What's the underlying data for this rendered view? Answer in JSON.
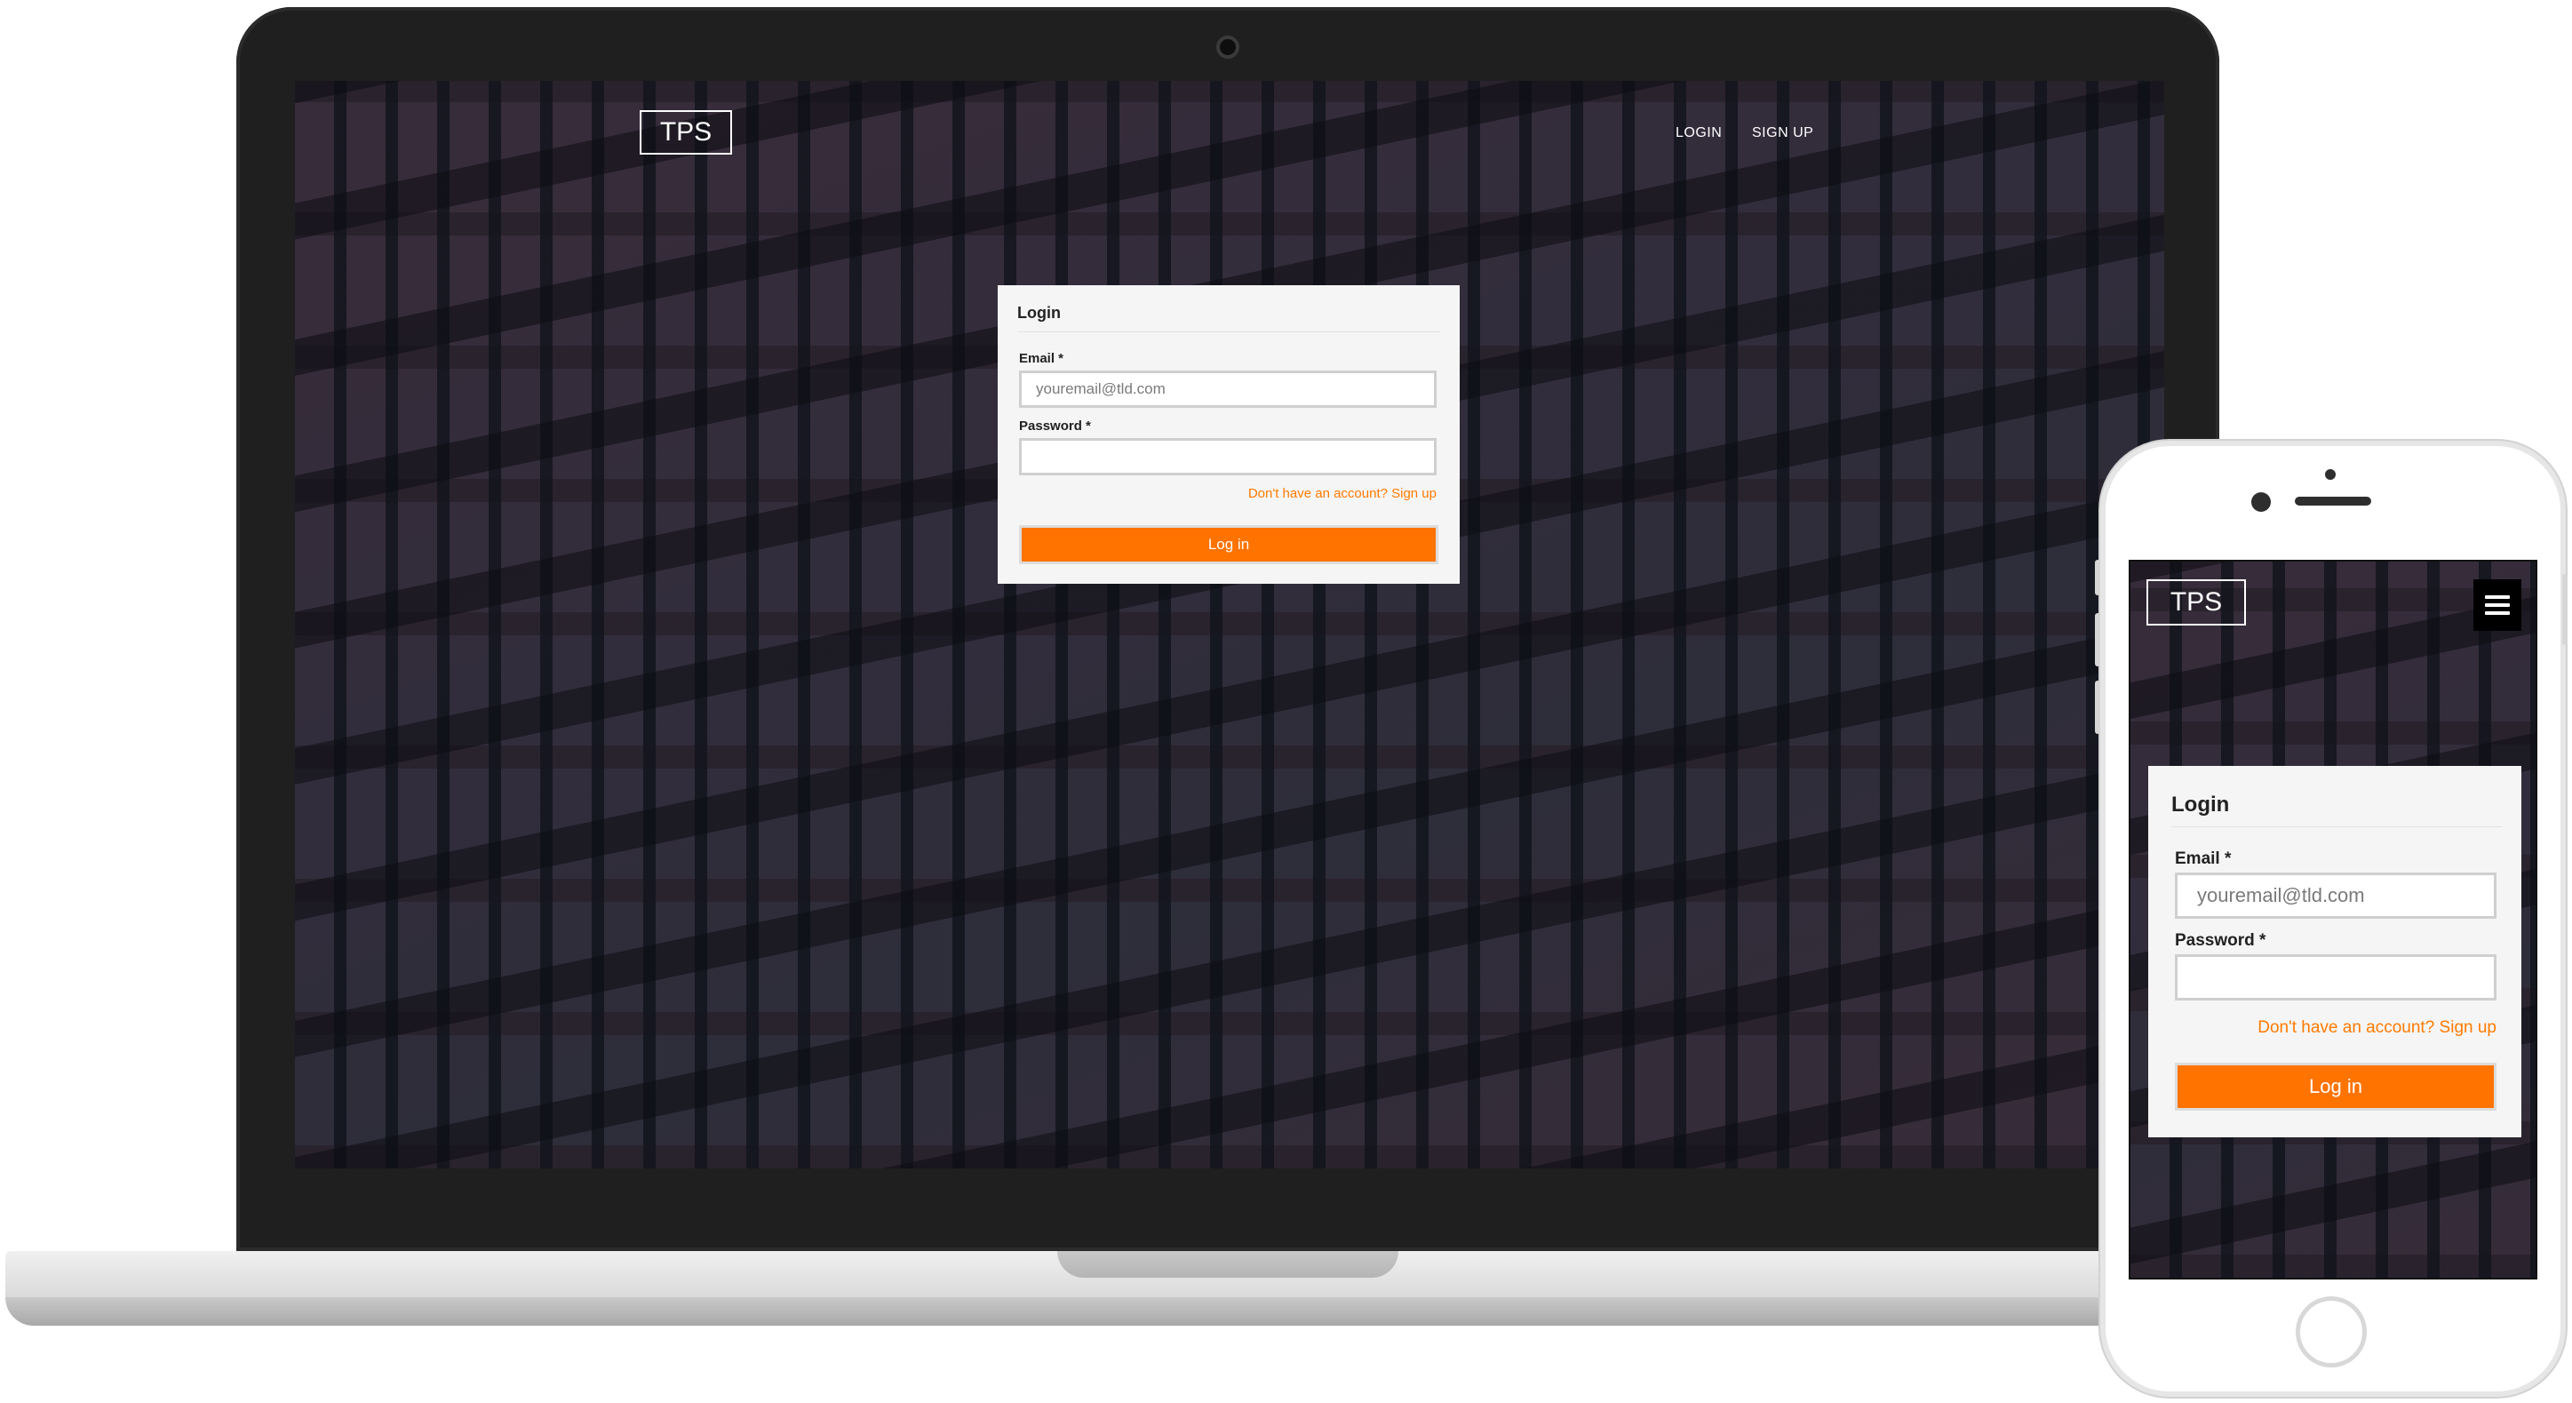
{
  "brand": {
    "logo_text": "TPS"
  },
  "nav": {
    "login_label": "LOGIN",
    "signup_label": "SIGN UP"
  },
  "login_card": {
    "title": "Login",
    "email_label": "Email *",
    "email_placeholder": "youremail@tld.com",
    "password_label": "Password *",
    "signup_prompt": "Don't have an account? Sign up",
    "submit_label": "Log in"
  },
  "colors": {
    "accent": "#ff7300",
    "link": "#ff7a00",
    "card_bg": "#f5f5f5",
    "device_frame": "#1f1f1f"
  },
  "icons": {
    "menu": "hamburger-menu-icon"
  }
}
